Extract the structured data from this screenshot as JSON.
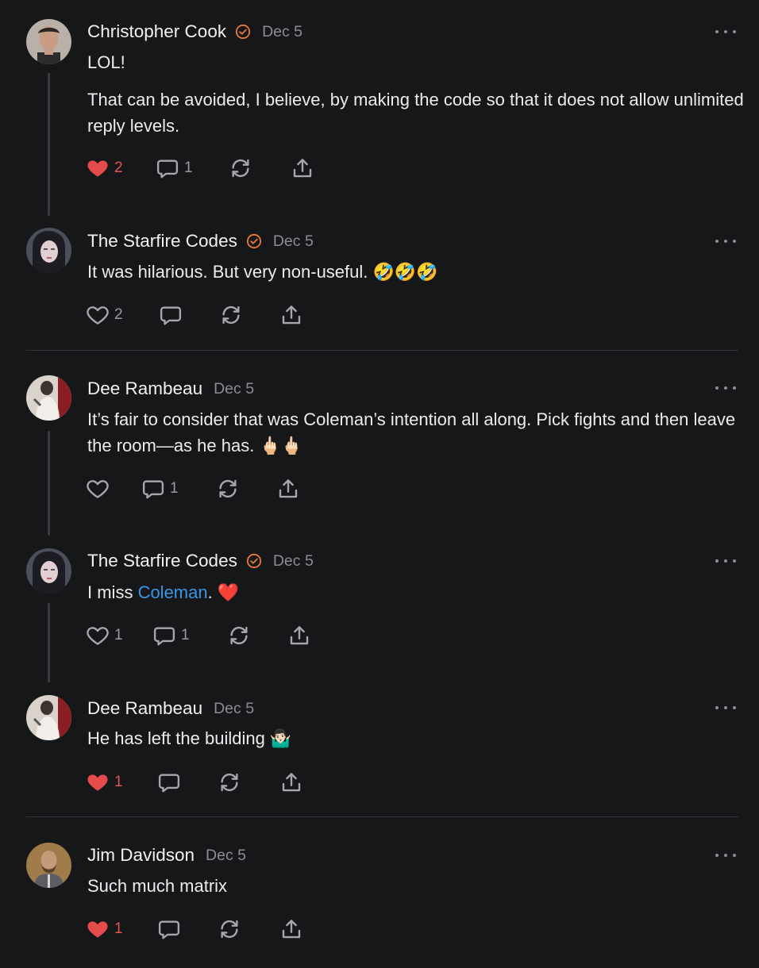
{
  "colors": {
    "background": "#161719",
    "verified": "#ea7a32",
    "like_red": "#e64b4b",
    "link": "#3a95e6"
  },
  "comments": [
    {
      "author": "Christopher Cook",
      "verified": true,
      "date": "Dec 5",
      "paragraphs": [
        "LOL!",
        "That can be avoided, I believe, by making the code so that it does not allow unlimited reply levels."
      ],
      "likes": "2",
      "liked": true,
      "replies": "1"
    },
    {
      "author": "The Starfire Codes",
      "verified": true,
      "date": "Dec 5",
      "text": "It was hilarious. But very non-useful. 🤣🤣🤣",
      "likes": "2",
      "liked": false,
      "replies": ""
    },
    {
      "author": "Dee Rambeau",
      "verified": false,
      "date": "Dec 5",
      "text": "It’s fair to consider that was Coleman’s intention all along. Pick fights and then leave the room—as he has. 🖕🏻🖕🏻",
      "likes": "",
      "liked": false,
      "replies": "1"
    },
    {
      "author": "The Starfire Codes",
      "verified": true,
      "date": "Dec 5",
      "text_before": "I miss ",
      "mention": "Coleman",
      "text_after": ". ❤️",
      "likes": "1",
      "liked": false,
      "replies": "1"
    },
    {
      "author": "Dee Rambeau",
      "verified": false,
      "date": "Dec 5",
      "text": "He has left the building 🤷🏻‍♂️",
      "likes": "1",
      "liked": true,
      "replies": ""
    },
    {
      "author": "Jim Davidson",
      "verified": false,
      "date": "Dec 5",
      "text": "Such much matrix",
      "likes": "1",
      "liked": true,
      "replies": ""
    }
  ],
  "icons": [
    "heart-icon",
    "comment-icon",
    "restack-icon",
    "share-icon",
    "more-icon",
    "verified-icon"
  ]
}
